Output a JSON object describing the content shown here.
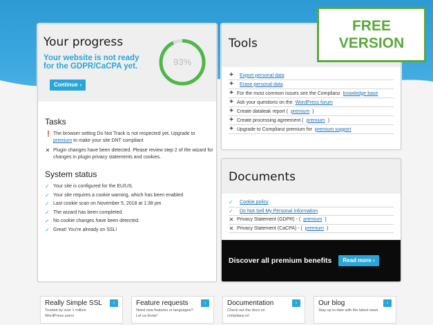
{
  "badge": {
    "line1": "FREE",
    "line2": "VERSION"
  },
  "progress": {
    "title": "Your progress",
    "message": "Your website is not ready for the GDPR/CaCPA yet.",
    "continue_label": "Continue",
    "percent_label": "93%",
    "percent": 93
  },
  "tasks": {
    "title": "Tasks",
    "items": [
      {
        "icon": "warning-icon",
        "text_before": "The browser setting Do Not Track is not respected yet. Upgrade to ",
        "link": "premium",
        "text_after": " to make your site DNT compliant"
      },
      {
        "icon": "cross-icon",
        "text_before": "Plugin changes have been detected. Please review step 2 of the wizard for changes in plugin privacy statements and cookies.",
        "link": "",
        "text_after": ""
      }
    ]
  },
  "system_status": {
    "title": "System status",
    "items": [
      "Your site is configured for the EU/US.",
      "Your site requires a cookie warning, which has been enabled",
      "Last cookie scan on November 5, 2018 at 1:38 pm",
      "The wizard has been completed.",
      "No cookie changes have been detected.",
      "Great! You're already on SSL!"
    ]
  },
  "tools": {
    "title": "Tools",
    "items": [
      {
        "before": "",
        "link": "Export personal data",
        "after": ""
      },
      {
        "before": "",
        "link": "Erase personal data",
        "after": ""
      },
      {
        "before": "For the most common issues see the Complianz ",
        "link": "knowledge base",
        "after": ""
      },
      {
        "before": "Ask your questions on the ",
        "link": "WordPress forum",
        "after": ""
      },
      {
        "before": "Create dataleak report (",
        "link": "premium",
        "after": ")"
      },
      {
        "before": "Create processing agreement (",
        "link": "premium",
        "after": ")"
      },
      {
        "before": "Upgrade to Complianz premium for ",
        "link": "premium support",
        "after": ""
      }
    ]
  },
  "documents": {
    "title": "Documents",
    "items": [
      {
        "icon": "check",
        "before": "",
        "link": "Cookie policy",
        "after": ""
      },
      {
        "icon": "check",
        "before": "",
        "link": "Do Not Sell My Personal Information",
        "after": ""
      },
      {
        "icon": "cross",
        "before": "Privacy Statement (GDPR) - (",
        "link": "premium",
        "after": ")"
      },
      {
        "icon": "cross",
        "before": "Privacy Statement (CaCPA) - (",
        "link": "premium",
        "after": ")"
      }
    ],
    "premium_text": "Discover all premium benefits",
    "premium_button": "Read more"
  },
  "tiles": [
    {
      "title": "Really Simple SSL",
      "sub": "Trusted by over 1 million WordPress users"
    },
    {
      "title": "Feature requests",
      "sub": "Need new features or languages? Let us know!"
    },
    {
      "title": "Documentation",
      "sub": "Check out the docs on complianz.io!"
    },
    {
      "title": "Our blog",
      "sub": "Stay up to date with the latest news"
    }
  ],
  "colors": {
    "accent": "#29a6d9",
    "badge": "#5aa839",
    "gauge": "#4db848"
  }
}
